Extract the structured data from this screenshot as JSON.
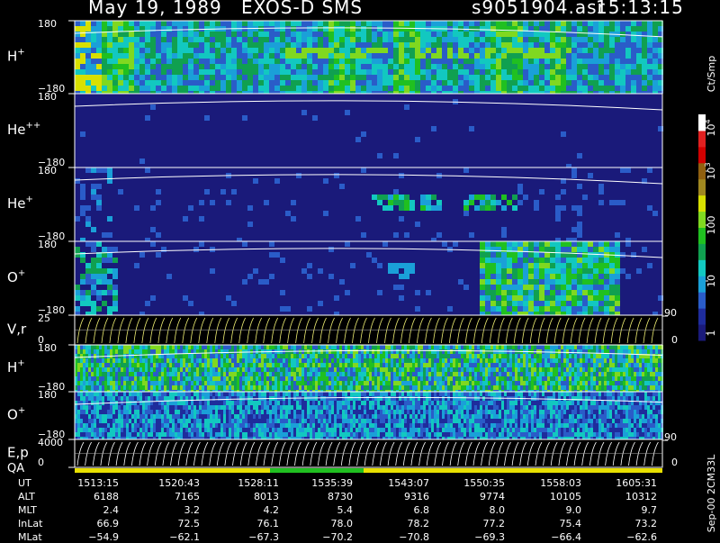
{
  "header": {
    "date": "May 19, 1989",
    "instrument": "EXOS-D SMS",
    "file": "s9051904.asr",
    "time": "15:13:15"
  },
  "side_label": "Sep-00 2CM33L",
  "chart_data": {
    "type": "heatmap",
    "panels": [
      {
        "label_base": "H",
        "label_sup": "+",
        "ymax": "180",
        "ymin": "−180"
      },
      {
        "label_base": "He",
        "label_sup": "++",
        "ymax": "180",
        "ymin": "−180"
      },
      {
        "label_base": "He",
        "label_sup": "+",
        "ymax": "180",
        "ymin": "−180"
      },
      {
        "label_base": "O",
        "label_sup": "+",
        "ymax": "180",
        "ymin": "−180"
      },
      {
        "label_base": "V,r",
        "label_sup": "",
        "ymax": "25",
        "ymin": "0",
        "right_max": "90",
        "right_min": "0"
      },
      {
        "label_base": "H",
        "label_sup": "+",
        "ymax": "180",
        "ymin": "−180"
      },
      {
        "label_base": "O",
        "label_sup": "+",
        "ymax": "180",
        "ymin": "−180"
      },
      {
        "label_base": "E,p",
        "label_sup": "",
        "ymax": "4000",
        "ymin": "0",
        "right_max": "90",
        "right_min": "0"
      }
    ],
    "qa_label": "QA",
    "colorbar": {
      "unit": "Ct/Smp",
      "ticks": [
        {
          "label": "1"
        },
        {
          "label": "10"
        },
        {
          "label": "100"
        },
        {
          "label": "10",
          "sup": "3"
        },
        {
          "label": "10",
          "sup": "4"
        }
      ]
    }
  },
  "table": {
    "rows": [
      {
        "name": "UT",
        "values": [
          "1513:15",
          "1520:43",
          "1528:11",
          "1535:39",
          "1543:07",
          "1550:35",
          "1558:03",
          "1605:31"
        ]
      },
      {
        "name": "ALT",
        "values": [
          "6188",
          "7165",
          "8013",
          "8730",
          "9316",
          "9774",
          "10105",
          "10312"
        ]
      },
      {
        "name": "MLT",
        "values": [
          "2.4",
          "3.2",
          "4.2",
          "5.4",
          "6.8",
          "8.0",
          "9.0",
          "9.7"
        ]
      },
      {
        "name": "InLat",
        "values": [
          "66.9",
          "72.5",
          "76.1",
          "78.0",
          "78.2",
          "77.2",
          "75.4",
          "73.2"
        ]
      },
      {
        "name": "MLat",
        "values": [
          "−54.9",
          "−62.1",
          "−67.3",
          "−70.2",
          "−70.8",
          "−69.3",
          "−66.4",
          "−62.6"
        ]
      }
    ]
  },
  "palette": [
    "#1a1a7a",
    "#1e2c9c",
    "#2a5cc8",
    "#1aa0d8",
    "#12c8c0",
    "#10a050",
    "#20c020",
    "#80d820",
    "#d8e000",
    "#a08820",
    "#d00000",
    "#ffffff"
  ]
}
